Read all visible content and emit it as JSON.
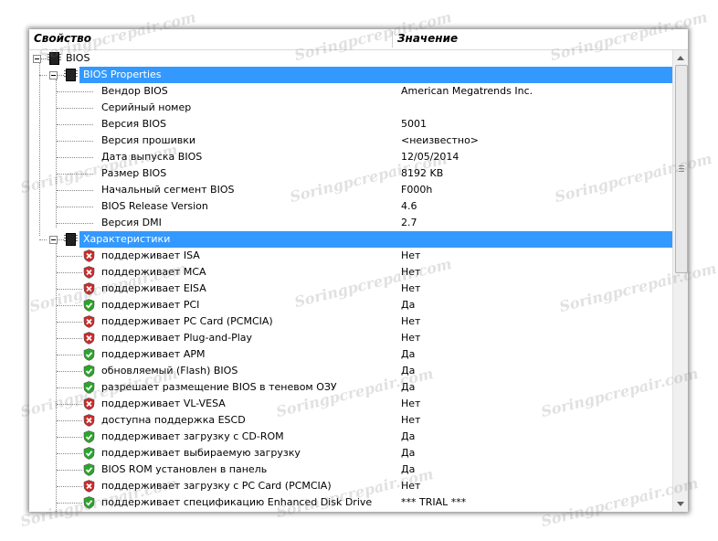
{
  "header": {
    "col_property": "Свойство",
    "col_value": "Значение"
  },
  "root_label": "BIOS",
  "group_props_label": "BIOS Properties",
  "props": [
    {
      "name": "Вендор BIOS",
      "value": "American Megatrends Inc."
    },
    {
      "name": "Серийный номер",
      "value": ""
    },
    {
      "name": "Версия BIOS",
      "value": "5001"
    },
    {
      "name": "Версия прошивки",
      "value": "<неизвестно>"
    },
    {
      "name": "Дата выпуска BIOS",
      "value": "12/05/2014"
    },
    {
      "name": "Размер BIOS",
      "value": "8192 KB"
    },
    {
      "name": "Начальный сегмент BIOS",
      "value": "F000h"
    },
    {
      "name": "BIOS Release Version",
      "value": "4.6"
    },
    {
      "name": "Версия DMI",
      "value": "2.7"
    }
  ],
  "group_features_label": "Характеристики",
  "features": [
    {
      "name": "поддерживает ISA",
      "value": "Нет",
      "supported": false
    },
    {
      "name": "поддерживает MCA",
      "value": "Нет",
      "supported": false
    },
    {
      "name": "поддерживает EISA",
      "value": "Нет",
      "supported": false
    },
    {
      "name": "поддерживает PCI",
      "value": "Да",
      "supported": true
    },
    {
      "name": "поддерживает PC Card (PCMCIA)",
      "value": "Нет",
      "supported": false
    },
    {
      "name": "поддерживает Plug-and-Play",
      "value": "Нет",
      "supported": false
    },
    {
      "name": "поддерживает APM",
      "value": "Да",
      "supported": true
    },
    {
      "name": "обновляемый (Flash) BIOS",
      "value": "Да",
      "supported": true
    },
    {
      "name": "разрешает размещение BIOS в теневом ОЗУ",
      "value": "Да",
      "supported": true
    },
    {
      "name": "поддерживает VL-VESA",
      "value": "Нет",
      "supported": false
    },
    {
      "name": "доступна поддержка ESCD",
      "value": "Нет",
      "supported": false
    },
    {
      "name": "поддерживает загрузку с CD-ROM",
      "value": "Да",
      "supported": true
    },
    {
      "name": "поддерживает выбираемую загрузку",
      "value": "Да",
      "supported": true
    },
    {
      "name": "BIOS ROM установлен в панель",
      "value": "Да",
      "supported": true
    },
    {
      "name": "поддерживает загрузку с PC Card (PCMCIA)",
      "value": "Нет",
      "supported": false
    },
    {
      "name": "поддерживает спецификацию Enhanced Disk Drive",
      "value": "*** TRIAL ***",
      "supported": true
    }
  ],
  "watermark_text": "Soringpcrepair.com",
  "colors": {
    "selection": "#3399ff",
    "shield_yes": "#2aa52a",
    "shield_no": "#cc2a2a"
  }
}
